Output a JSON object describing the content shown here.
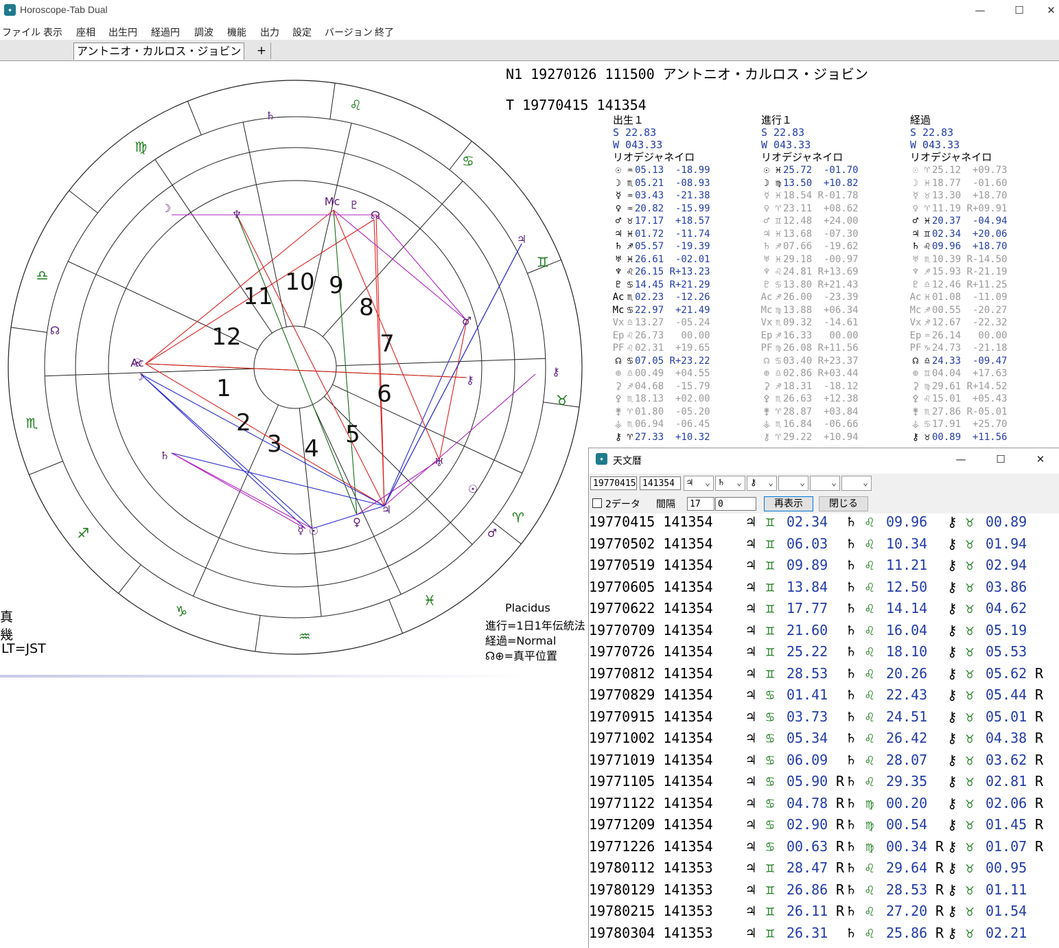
{
  "window": {
    "title": "Horoscope-Tab Dual",
    "min": "—",
    "max": "☐",
    "close": "✕"
  },
  "menu": [
    "ファイル",
    "表示",
    "座相",
    "出生円",
    "経過円",
    "調波",
    "機能",
    "出力",
    "設定",
    "バージョン",
    "終了"
  ],
  "tabs": {
    "active": "アントニオ・カルロス・ジョビン",
    "add": "+"
  },
  "header": {
    "line1": "N1  19270126 111500  アントニオ・カルロス・ジョビン",
    "line2": "T   19770415 141354"
  },
  "columns": [
    {
      "title": "出生１",
      "s": "S  22.83",
      "w": "W 043.33",
      "place": "リオデジャネイロ"
    },
    {
      "title": "進行１",
      "s": "S  22.83",
      "w": "W 043.33",
      "place": "リオデジャネイロ"
    },
    {
      "title": "経過",
      "s": "S  22.83",
      "w": "W 043.33",
      "place": "リオデジャネイロ"
    }
  ],
  "natal_rows": [
    {
      "p": "☉",
      "s": "♒",
      "v": "05.13  -18.99",
      "c": "nb"
    },
    {
      "p": "☽",
      "s": "♏",
      "v": "05.21  -08.93",
      "c": "nb"
    },
    {
      "p": "☿",
      "s": "♒",
      "v": "03.43  -21.38",
      "c": "nb"
    },
    {
      "p": "♀",
      "s": "♒",
      "v": "20.82  -15.99",
      "c": "nb"
    },
    {
      "p": "♂",
      "s": "♉",
      "v": "17.17  +18.57",
      "c": "nb"
    },
    {
      "p": "♃",
      "s": "♓",
      "v": "01.72  -11.74",
      "c": "nb"
    },
    {
      "p": "♄",
      "s": "♐",
      "v": "05.57  -19.39",
      "c": "nb"
    },
    {
      "p": "♅",
      "s": "♓",
      "v": "26.61  -02.01",
      "c": "nb"
    },
    {
      "p": "♆",
      "s": "♌",
      "v": "26.15 R+13.23",
      "c": "nb"
    },
    {
      "p": "♇",
      "s": "♋",
      "v": "14.45 R+21.29",
      "c": "nb"
    },
    {
      "p": "Ac",
      "s": "♏",
      "v": "02.23  -12.26",
      "c": "nb"
    },
    {
      "p": "Mc",
      "s": "♋",
      "v": "22.97  +21.49",
      "c": "nb"
    },
    {
      "p": "Vx",
      "s": "♎",
      "v": "13.27  -05.24",
      "c": "g"
    },
    {
      "p": "Ep",
      "s": "♌",
      "v": "26.73   00.00",
      "c": "g"
    },
    {
      "p": "PF",
      "s": "♌",
      "v": "02.31  +19.65",
      "c": "g"
    },
    {
      "p": "☊",
      "s": "♋",
      "v": "07.05 R+23.22",
      "c": "nb"
    },
    {
      "p": "⊕",
      "s": "♎",
      "v": "00.49  +04.55",
      "c": "g"
    },
    {
      "p": "⚳",
      "s": "♐",
      "v": "04.68  -15.79",
      "c": "g"
    },
    {
      "p": "⚴",
      "s": "♏",
      "v": "18.13  +02.00",
      "c": "g"
    },
    {
      "p": "⚵",
      "s": "♈",
      "v": "01.80  -05.20",
      "c": "g"
    },
    {
      "p": "⚶",
      "s": "♏",
      "v": "06.94  -06.45",
      "c": "g"
    },
    {
      "p": "⚷",
      "s": "♈",
      "v": "27.33  +10.32",
      "c": "nb"
    }
  ],
  "progressed_rows": [
    {
      "p": "☉",
      "s": "♓",
      "v": "25.72  -01.70",
      "c": "nb"
    },
    {
      "p": "☽",
      "s": "♍",
      "v": "13.50  +10.82",
      "c": "nb"
    },
    {
      "p": "☿",
      "s": "♓",
      "v": "18.54 R-01.78",
      "c": "g"
    },
    {
      "p": "♀",
      "s": "♈",
      "v": "23.11  +08.62",
      "c": "g"
    },
    {
      "p": "♂",
      "s": "♊",
      "v": "12.48  +24.00",
      "c": "g"
    },
    {
      "p": "♃",
      "s": "♓",
      "v": "13.68  -07.30",
      "c": "g"
    },
    {
      "p": "♄",
      "s": "♐",
      "v": "07.66  -19.62",
      "c": "g"
    },
    {
      "p": "♅",
      "s": "♓",
      "v": "29.18  -00.97",
      "c": "g"
    },
    {
      "p": "♆",
      "s": "♌",
      "v": "24.81 R+13.69",
      "c": "g"
    },
    {
      "p": "♇",
      "s": "♋",
      "v": "13.80 R+21.43",
      "c": "g"
    },
    {
      "p": "Ac",
      "s": "♐",
      "v": "26.00  -23.39",
      "c": "g"
    },
    {
      "p": "Mc",
      "s": "♍",
      "v": "13.88  +06.34",
      "c": "g"
    },
    {
      "p": "Vx",
      "s": "♏",
      "v": "09.32  -14.61",
      "c": "g"
    },
    {
      "p": "Ep",
      "s": "♐",
      "v": "16.33   00.00",
      "c": "g"
    },
    {
      "p": "PF",
      "s": "♍",
      "v": "26.08 R+11.56",
      "c": "g"
    },
    {
      "p": "☊",
      "s": "♋",
      "v": "03.40 R+23.37",
      "c": "g"
    },
    {
      "p": "⊕",
      "s": "♎",
      "v": "02.86 R+03.44",
      "c": "g"
    },
    {
      "p": "⚳",
      "s": "♐",
      "v": "18.31  -18.12",
      "c": "g"
    },
    {
      "p": "⚴",
      "s": "♏",
      "v": "26.63  +12.38",
      "c": "g"
    },
    {
      "p": "⚵",
      "s": "♈",
      "v": "28.87  +03.84",
      "c": "g"
    },
    {
      "p": "⚶",
      "s": "♏",
      "v": "16.84  -06.66",
      "c": "g"
    },
    {
      "p": "⚷",
      "s": "♈",
      "v": "29.22  +10.94",
      "c": "g"
    }
  ],
  "transit_rows": [
    {
      "p": "☉",
      "s": "♈",
      "v": "25.12  +09.73",
      "c": "g"
    },
    {
      "p": "☽",
      "s": "♓",
      "v": "18.77  -01.60",
      "c": "g"
    },
    {
      "p": "☿",
      "s": "♉",
      "v": "13.30  +18.70",
      "c": "g"
    },
    {
      "p": "♀",
      "s": "♈",
      "v": "11.19 R+09.91",
      "c": "g"
    },
    {
      "p": "♂",
      "s": "♓",
      "v": "20.37  -04.94",
      "c": "nb"
    },
    {
      "p": "♃",
      "s": "♊",
      "v": "02.34  +20.06",
      "c": "nb"
    },
    {
      "p": "♄",
      "s": "♌",
      "v": "09.96  +18.70",
      "c": "nb"
    },
    {
      "p": "♅",
      "s": "♏",
      "v": "10.39 R-14.50",
      "c": "g"
    },
    {
      "p": "♆",
      "s": "♐",
      "v": "15.93 R-21.19",
      "c": "g"
    },
    {
      "p": "♇",
      "s": "♎",
      "v": "12.46 R+11.25",
      "c": "g"
    },
    {
      "p": "Ac",
      "s": "♓",
      "v": "01.08  -11.09",
      "c": "g"
    },
    {
      "p": "Mc",
      "s": "♐",
      "v": "00.55  -20.27",
      "c": "g"
    },
    {
      "p": "Vx",
      "s": "♐",
      "v": "12.67  -22.32",
      "c": "g"
    },
    {
      "p": "Ep",
      "s": "♒",
      "v": "26.14   00.00",
      "c": "g"
    },
    {
      "p": "PF",
      "s": "♑",
      "v": "24.73  -21.18",
      "c": "g"
    },
    {
      "p": "☊",
      "s": "♎",
      "v": "24.33  -09.47",
      "c": "nb"
    },
    {
      "p": "⊕",
      "s": "♊",
      "v": "04.04  +17.63",
      "c": "g"
    },
    {
      "p": "⚳",
      "s": "♍",
      "v": "29.61 R+14.52",
      "c": "g"
    },
    {
      "p": "⚴",
      "s": "♌",
      "v": "15.01  +05.43",
      "c": "g"
    },
    {
      "p": "⚵",
      "s": "♏",
      "v": "27.86 R-05.01",
      "c": "g"
    },
    {
      "p": "⚶",
      "s": "♋",
      "v": "17.91  +25.70",
      "c": "g"
    },
    {
      "p": "⚷",
      "s": "♉",
      "v": "00.89  +11.56",
      "c": "nb"
    }
  ],
  "chart_labels": {
    "system": "Placidus",
    "progression": "進行=1日1年伝統法",
    "transit": "経過=Normal",
    "node": "☊⊕=真平位置",
    "left1": "真",
    "left2": "幾",
    "left3": "LT=JST"
  },
  "house_numbers": [
    "1",
    "2",
    "3",
    "4",
    "5",
    "6",
    "7",
    "8",
    "9",
    "10",
    "11",
    "12"
  ],
  "subwindow": {
    "title": "天文暦",
    "min": "—",
    "max": "☐",
    "close": "✕",
    "date": "19770415",
    "time": "141354",
    "combo1": "♃",
    "combo2": "♄",
    "combo3": "⚷",
    "combo4": "",
    "combo5": "",
    "combo6": "",
    "checkbox_label": "2データ",
    "interval_label": "間隔",
    "interval_value": "17",
    "interval_value2": "0",
    "redraw": "再表示",
    "close_btn": "閉じる"
  },
  "ephemeris_rows": [
    {
      "d": "19770415 141354",
      "j": "♊",
      "jv": "02.34",
      "jr": "",
      "s": "♌",
      "sv": "09.96",
      "sr": "",
      "c": "♉",
      "cv": "00.89",
      "cr": "",
      "e": ""
    },
    {
      "d": "19770502 141354",
      "j": "♊",
      "jv": "06.03",
      "jr": "",
      "s": "♌",
      "sv": "10.34",
      "sr": "",
      "c": "♉",
      "cv": "01.94",
      "cr": "",
      "e": ""
    },
    {
      "d": "19770519 141354",
      "j": "♊",
      "jv": "09.89",
      "jr": "",
      "s": "♌",
      "sv": "11.21",
      "sr": "",
      "c": "♉",
      "cv": "02.94",
      "cr": "",
      "e": ""
    },
    {
      "d": "19770605 141354",
      "j": "♊",
      "jv": "13.84",
      "jr": "",
      "s": "♌",
      "sv": "12.50",
      "sr": "",
      "c": "♉",
      "cv": "03.86",
      "cr": "",
      "e": ""
    },
    {
      "d": "19770622 141354",
      "j": "♊",
      "jv": "17.77",
      "jr": "",
      "s": "♌",
      "sv": "14.14",
      "sr": "",
      "c": "♉",
      "cv": "04.62",
      "cr": "",
      "e": ""
    },
    {
      "d": "19770709 141354",
      "j": "♊",
      "jv": "21.60",
      "jr": "",
      "s": "♌",
      "sv": "16.04",
      "sr": "",
      "c": "♉",
      "cv": "05.19",
      "cr": "",
      "e": ""
    },
    {
      "d": "19770726 141354",
      "j": "♊",
      "jv": "25.22",
      "jr": "",
      "s": "♌",
      "sv": "18.10",
      "sr": "",
      "c": "♉",
      "cv": "05.53",
      "cr": "",
      "e": ""
    },
    {
      "d": "19770812 141354",
      "j": "♊",
      "jv": "28.53",
      "jr": "",
      "s": "♌",
      "sv": "20.26",
      "sr": "",
      "c": "♉",
      "cv": "05.62",
      "cr": "",
      "e": "R"
    },
    {
      "d": "19770829 141354",
      "j": "♋",
      "jv": "01.41",
      "jr": "",
      "s": "♌",
      "sv": "22.43",
      "sr": "",
      "c": "♉",
      "cv": "05.44",
      "cr": "",
      "e": "R"
    },
    {
      "d": "19770915 141354",
      "j": "♋",
      "jv": "03.73",
      "jr": "",
      "s": "♌",
      "sv": "24.51",
      "sr": "",
      "c": "♉",
      "cv": "05.01",
      "cr": "",
      "e": "R"
    },
    {
      "d": "19771002 141354",
      "j": "♋",
      "jv": "05.34",
      "jr": "",
      "s": "♌",
      "sv": "26.42",
      "sr": "",
      "c": "♉",
      "cv": "04.38",
      "cr": "",
      "e": "R"
    },
    {
      "d": "19771019 141354",
      "j": "♋",
      "jv": "06.09",
      "jr": "",
      "s": "♌",
      "sv": "28.07",
      "sr": "",
      "c": "♉",
      "cv": "03.62",
      "cr": "",
      "e": "R"
    },
    {
      "d": "19771105 141354",
      "j": "♋",
      "jv": "05.90",
      "jr": "R",
      "s": "♌",
      "sv": "29.35",
      "sr": "",
      "c": "♉",
      "cv": "02.81",
      "cr": "",
      "e": "R"
    },
    {
      "d": "19771122 141354",
      "j": "♋",
      "jv": "04.78",
      "jr": "R",
      "s": "♍",
      "sv": "00.20",
      "sr": "",
      "c": "♉",
      "cv": "02.06",
      "cr": "",
      "e": "R"
    },
    {
      "d": "19771209 141354",
      "j": "♋",
      "jv": "02.90",
      "jr": "R",
      "s": "♍",
      "sv": "00.54",
      "sr": "",
      "c": "♉",
      "cv": "01.45",
      "cr": "",
      "e": "R"
    },
    {
      "d": "19771226 141354",
      "j": "♋",
      "jv": "00.63",
      "jr": "R",
      "s": "♍",
      "sv": "00.34",
      "sr": "R",
      "c": "♉",
      "cv": "01.07",
      "cr": "",
      "e": "R"
    },
    {
      "d": "19780112 141353",
      "j": "♊",
      "jv": "28.47",
      "jr": "R",
      "s": "♌",
      "sv": "29.64",
      "sr": "R",
      "c": "♉",
      "cv": "00.95",
      "cr": "",
      "e": ""
    },
    {
      "d": "19780129 141353",
      "j": "♊",
      "jv": "26.86",
      "jr": "R",
      "s": "♌",
      "sv": "28.53",
      "sr": "R",
      "c": "♉",
      "cv": "01.11",
      "cr": "",
      "e": ""
    },
    {
      "d": "19780215 141353",
      "j": "♊",
      "jv": "26.11",
      "jr": "R",
      "s": "♌",
      "sv": "27.20",
      "sr": "R",
      "c": "♉",
      "cv": "01.54",
      "cr": "",
      "e": ""
    },
    {
      "d": "19780304 141353",
      "j": "♊",
      "jv": "26.31",
      "jr": "",
      "s": "♌",
      "sv": "25.86",
      "sr": "R",
      "c": "♉",
      "cv": "02.21",
      "cr": "",
      "e": ""
    }
  ]
}
